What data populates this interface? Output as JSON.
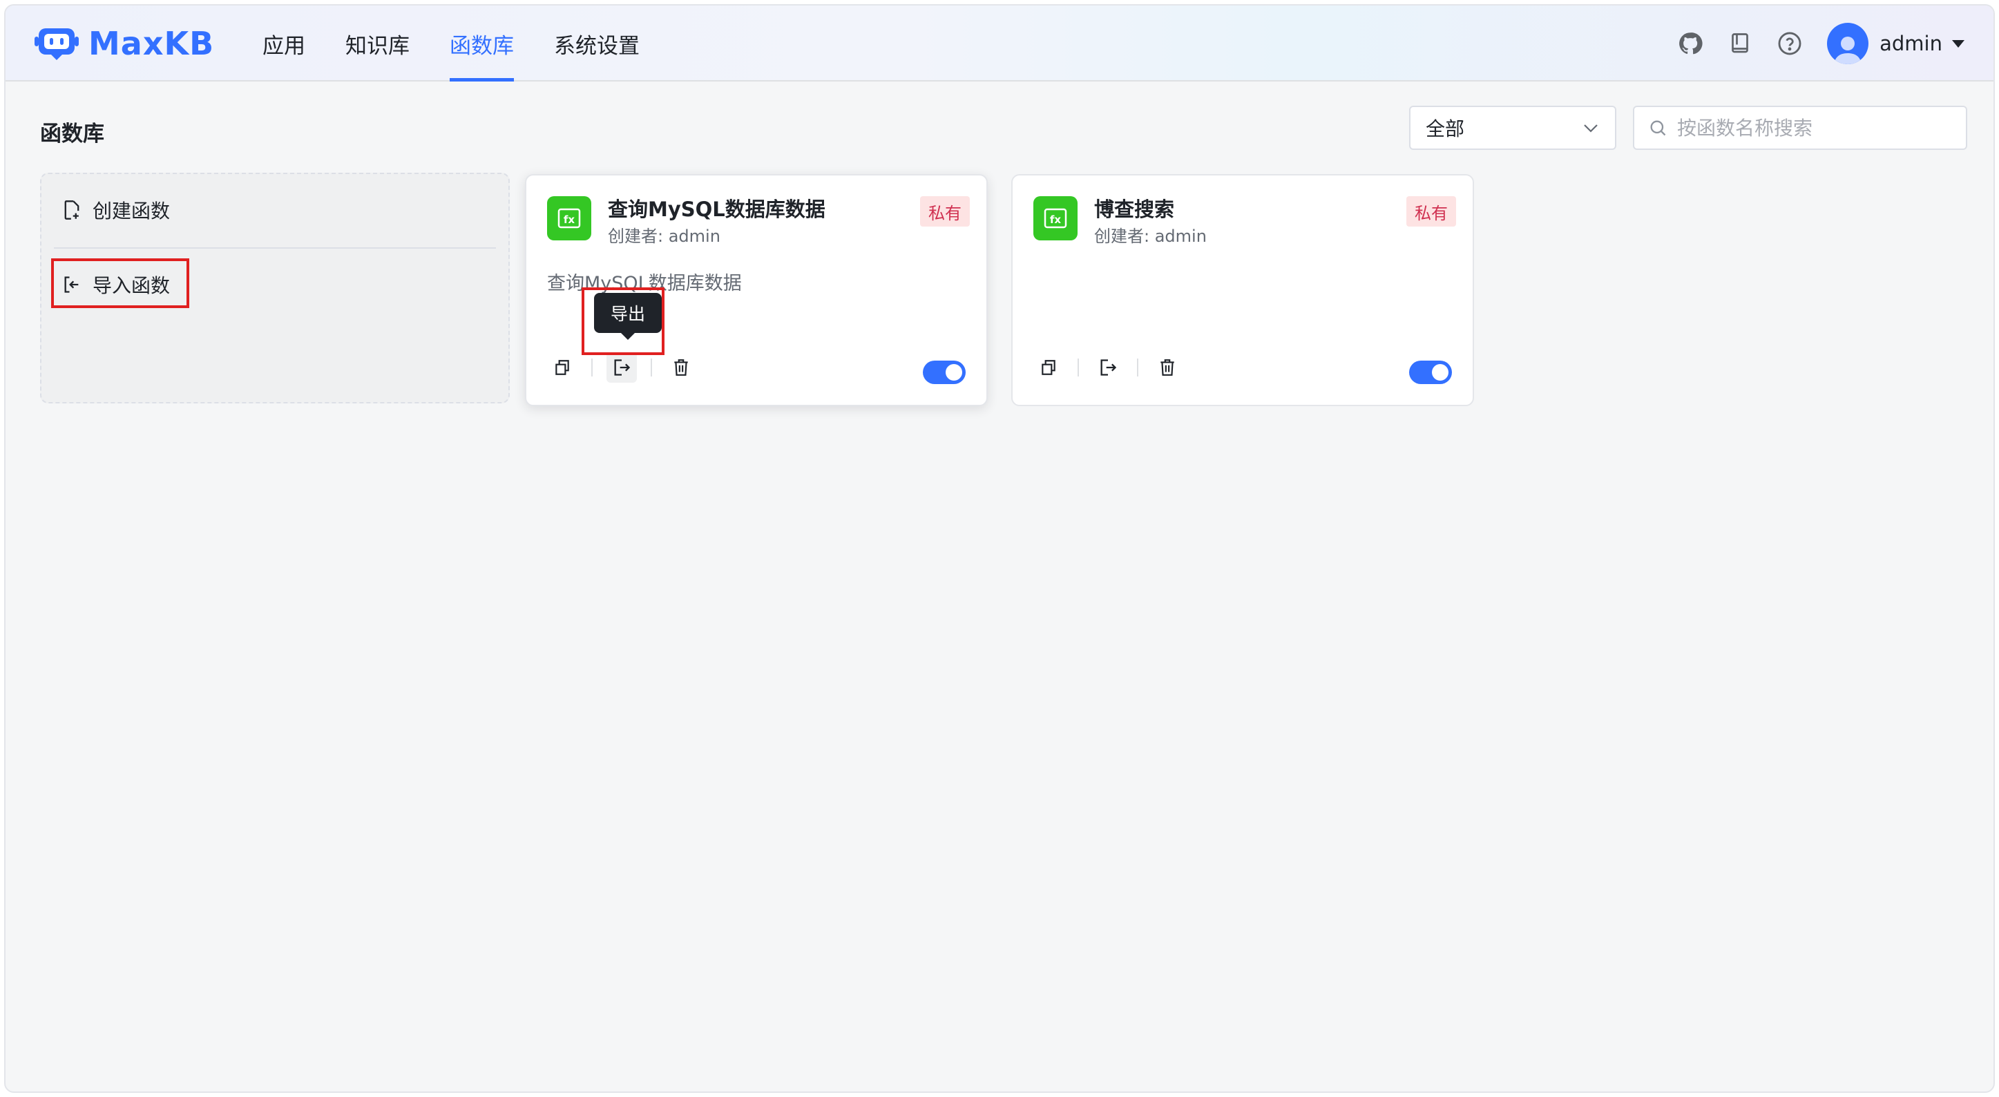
{
  "header": {
    "brand": "MaxKB",
    "nav": [
      {
        "label": "应用",
        "active": false
      },
      {
        "label": "知识库",
        "active": false
      },
      {
        "label": "函数库",
        "active": true
      },
      {
        "label": "系统设置",
        "active": false
      }
    ],
    "icons": [
      "github-icon",
      "book-icon",
      "help-icon"
    ],
    "user_name": "admin"
  },
  "page": {
    "title": "函数库",
    "filter_value": "全部",
    "search_placeholder": "按函数名称搜索"
  },
  "create_card": {
    "create_label": "创建函数",
    "import_label": "导入函数"
  },
  "functions": [
    {
      "name": "查询MySQL数据库数据",
      "creator": "创建者: admin",
      "badge": "私有",
      "description": "查询MySQL数据库数据",
      "enabled": true
    },
    {
      "name": "博查搜索",
      "creator": "创建者: admin",
      "badge": "私有",
      "description": "",
      "enabled": true
    }
  ],
  "tooltip": {
    "text": "导出"
  },
  "colors": {
    "accent": "#3370ff",
    "fx_icon": "#34c724",
    "badge_bg": "#fde3e3",
    "badge_text": "#d03050",
    "annotation": "#e02020"
  }
}
